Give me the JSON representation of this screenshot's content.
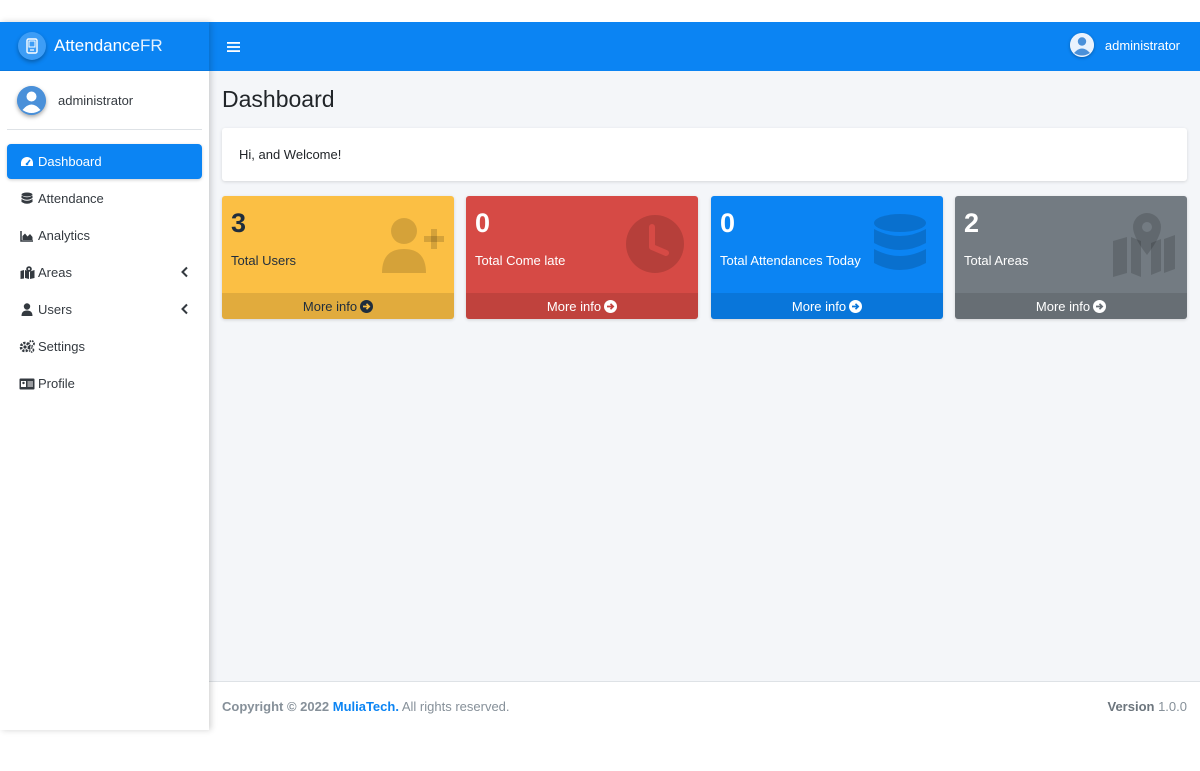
{
  "brand": {
    "name_bold": "Attendance",
    "name_light": "FR"
  },
  "user": {
    "name": "administrator"
  },
  "topbar": {
    "menu_icon": "bars-icon",
    "user_name": "administrator"
  },
  "sidebar": {
    "items": [
      {
        "label": "Dashboard",
        "icon": "tachometer-icon",
        "active": true
      },
      {
        "label": "Attendance",
        "icon": "database-icon"
      },
      {
        "label": "Analytics",
        "icon": "chart-area-icon"
      },
      {
        "label": "Areas",
        "icon": "map-marked-icon",
        "has_submenu": true
      },
      {
        "label": "Users",
        "icon": "user-icon",
        "has_submenu": true
      },
      {
        "label": "Settings",
        "icon": "cogs-icon"
      },
      {
        "label": "Profile",
        "icon": "id-card-icon"
      }
    ]
  },
  "page": {
    "title": "Dashboard",
    "welcome": "Hi, and Welcome!"
  },
  "stats": [
    {
      "value": "3",
      "label": "Total Users",
      "footer": "More info",
      "icon": "user-plus-icon",
      "color": "#fbbf44"
    },
    {
      "value": "0",
      "label": "Total Come late",
      "footer": "More info",
      "icon": "clock-icon",
      "color": "#d64a45"
    },
    {
      "value": "0",
      "label": "Total Attendances Today",
      "footer": "More info",
      "icon": "database-icon",
      "color": "#0b84f3"
    },
    {
      "value": "2",
      "label": "Total Areas",
      "footer": "More info",
      "icon": "map-marked-icon",
      "color": "#737b82"
    }
  ],
  "footer": {
    "copyright": "Copyright © 2022",
    "company": "MuliaTech.",
    "rights": "All rights reserved.",
    "version_label": "Version",
    "version_value": "1.0.0"
  },
  "colors": {
    "primary": "#0b84f3",
    "warning": "#fbbf44",
    "danger": "#d64a45",
    "secondary": "#737b82",
    "background": "#f4f6f9"
  }
}
